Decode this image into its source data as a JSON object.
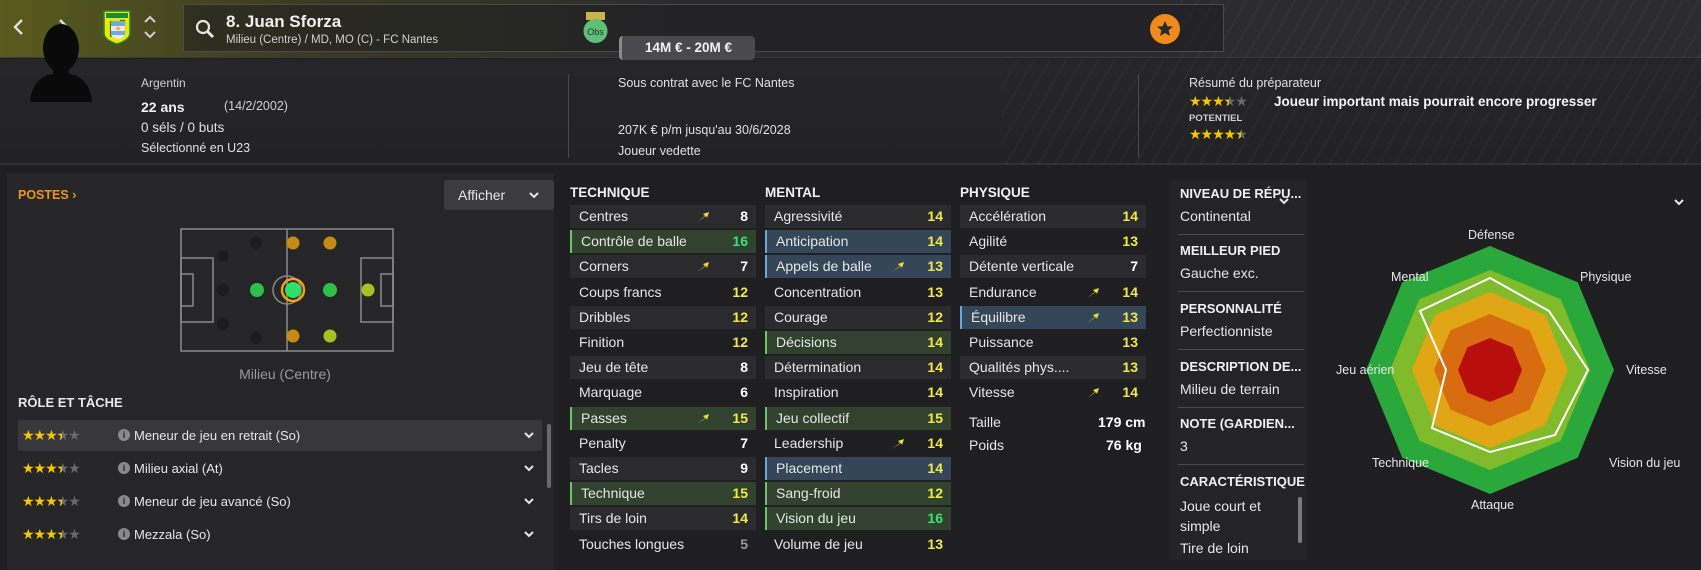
{
  "header": {
    "player_name": "8. Juan Sforza",
    "player_sub": "Milieu (Centre) / MD, MO (C) - FC Nantes",
    "back_icon": "chevron-left-icon",
    "forward_icon": "chevron-right-icon"
  },
  "profile": {
    "nationality": "Argentin",
    "age": "22 ans",
    "dob": "(14/2/2002)",
    "caps": "0 séls / 0 buts",
    "selection": "Sélectionné en U23"
  },
  "contract": {
    "obs_badge": "Obs",
    "title": "Sous contrat avec le FC Nantes",
    "value_range": "14M € - 20M €",
    "wage": "207K € p/m jusqu'au 30/6/2028",
    "status": "Joueur vedette"
  },
  "coach": {
    "title": "Résumé du préparateur",
    "current_stars": 3.5,
    "summary": "Joueur important mais pourrait encore progresser",
    "potential_label": "POTENTIEL",
    "potential_stars": 4.5
  },
  "positions": {
    "title": "POSTES",
    "show_button": "Afficher",
    "pitch_caption": "Milieu (Centre)"
  },
  "roles": {
    "title": "RÔLE ET TÂCHE",
    "items": [
      {
        "stars": 3.5,
        "label": "Meneur de jeu en retrait (So)"
      },
      {
        "stars": 3.5,
        "label": "Milieu axial (At)"
      },
      {
        "stars": 3.5,
        "label": "Meneur de jeu avancé (So)"
      },
      {
        "stars": 3.5,
        "label": "Mezzala (So)"
      }
    ]
  },
  "attributes": {
    "technique": {
      "title": "TECHNIQUE",
      "items": [
        {
          "name": "Centres",
          "value": 8,
          "arrow": true
        },
        {
          "name": "Contrôle de balle",
          "value": 16,
          "hl": "g"
        },
        {
          "name": "Corners",
          "value": 7,
          "arrow": true
        },
        {
          "name": "Coups francs",
          "value": 12
        },
        {
          "name": "Dribbles",
          "value": 12
        },
        {
          "name": "Finition",
          "value": 12
        },
        {
          "name": "Jeu de tête",
          "value": 8
        },
        {
          "name": "Marquage",
          "value": 6
        },
        {
          "name": "Passes",
          "value": 15,
          "hl": "g",
          "arrow": true
        },
        {
          "name": "Penalty",
          "value": 7
        },
        {
          "name": "Tacles",
          "value": 9
        },
        {
          "name": "Technique",
          "value": 15,
          "hl": "g"
        },
        {
          "name": "Tirs de loin",
          "value": 14
        },
        {
          "name": "Touches longues",
          "value": 5
        }
      ]
    },
    "mental": {
      "title": "MENTAL",
      "items": [
        {
          "name": "Agressivité",
          "value": 14
        },
        {
          "name": "Anticipation",
          "value": 14,
          "hl": "b"
        },
        {
          "name": "Appels de balle",
          "value": 13,
          "hl": "b",
          "arrow": true
        },
        {
          "name": "Concentration",
          "value": 13
        },
        {
          "name": "Courage",
          "value": 12
        },
        {
          "name": "Décisions",
          "value": 14,
          "hl": "g"
        },
        {
          "name": "Détermination",
          "value": 14
        },
        {
          "name": "Inspiration",
          "value": 14
        },
        {
          "name": "Jeu collectif",
          "value": 15,
          "hl": "g"
        },
        {
          "name": "Leadership",
          "value": 14,
          "arrow": true
        },
        {
          "name": "Placement",
          "value": 14,
          "hl": "b"
        },
        {
          "name": "Sang-froid",
          "value": 12,
          "hl": "g"
        },
        {
          "name": "Vision du jeu",
          "value": 16,
          "hl": "g"
        },
        {
          "name": "Volume de jeu",
          "value": 13
        }
      ]
    },
    "physique": {
      "title": "PHYSIQUE",
      "items": [
        {
          "name": "Accélération",
          "value": 14
        },
        {
          "name": "Agilité",
          "value": 13
        },
        {
          "name": "Détente verticale",
          "value": 7
        },
        {
          "name": "Endurance",
          "value": 14,
          "arrow": true
        },
        {
          "name": "Équilibre",
          "value": 13,
          "hl": "b",
          "arrow": true
        },
        {
          "name": "Puissance",
          "value": 13
        },
        {
          "name": "Qualités phys....",
          "value": 13
        },
        {
          "name": "Vitesse",
          "value": 14,
          "arrow": true
        }
      ],
      "height_label": "Taille",
      "height_value": "179 cm",
      "weight_label": "Poids",
      "weight_value": "76 kg"
    }
  },
  "details": {
    "reputation_title": "NIVEAU DE RÉPU...",
    "reputation_value": "Continental",
    "foot_title": "MEILLEUR PIED",
    "foot_value": "Gauche exc.",
    "personality_title": "PERSONNALITÉ",
    "personality_value": "Perfectionniste",
    "description_title": "DESCRIPTION DE...",
    "description_value": "Milieu de terrain",
    "gk_title": "NOTE (GARDIEN...",
    "gk_value": "3",
    "traits_title": "CARACTÉRISTIQUE",
    "traits_line1": "Joue court et",
    "traits_line2": "simple",
    "traits_line3": "Tire de loin"
  },
  "radar": {
    "labels": [
      "Défense",
      "Physique",
      "Vitesse",
      "Vision du jeu",
      "Attaque",
      "Technique",
      "Jeu aérien",
      "Mental"
    ]
  },
  "colors": {
    "accent_orange": "#f0941e",
    "star_yellow": "#f5c800",
    "value_yellow": "#f2e84a",
    "value_green": "#3fe07a"
  }
}
